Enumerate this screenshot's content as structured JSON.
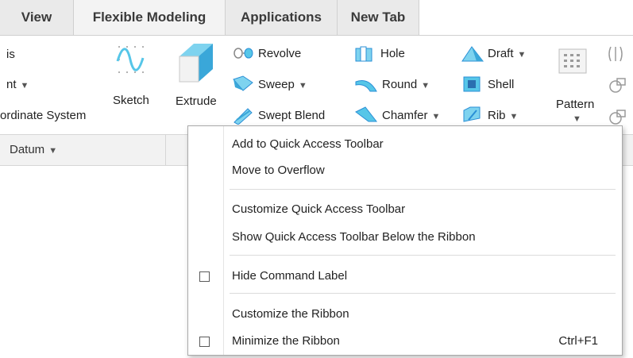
{
  "tabs": [
    {
      "label": "View"
    },
    {
      "label": "Flexible Modeling"
    },
    {
      "label": "Applications"
    },
    {
      "label": "New Tab"
    }
  ],
  "ribbon": {
    "datum_items": [
      "is",
      "nt",
      "ordinate System"
    ],
    "sketch_label": "Sketch",
    "extrude_label": "Extrude",
    "shape_items": [
      "Revolve",
      "Sweep",
      "Swept Blend"
    ],
    "engineering_col1": [
      "Hole",
      "Round",
      "Chamfer"
    ],
    "engineering_col2": [
      "Draft",
      "Shell",
      "Rib"
    ],
    "pattern_label": "Pattern",
    "group_label": "Datum"
  },
  "context_menu": {
    "items": [
      {
        "label": "Add to Quick Access Toolbar"
      },
      {
        "label": "Move to Overflow"
      },
      {
        "label": "Customize Quick Access Toolbar"
      },
      {
        "label": "Show Quick Access Toolbar Below the Ribbon"
      },
      {
        "label": "Hide Command Label",
        "checked": false
      },
      {
        "label": "Customize the Ribbon"
      },
      {
        "label": "Minimize the Ribbon",
        "checked": false,
        "shortcut": "Ctrl+F1"
      }
    ]
  },
  "colors": {
    "accent_blue": "#2a8fd6",
    "icon_cyan": "#56c6e8",
    "gray": "#9a9a9a"
  }
}
